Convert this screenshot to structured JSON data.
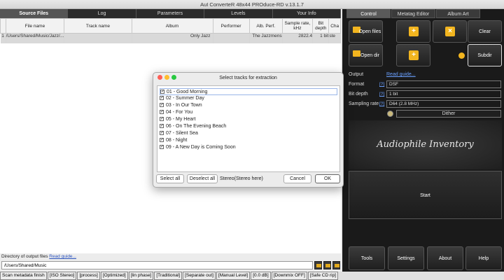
{
  "window": {
    "title": "AuI ConverteR 48x44 PROduce-RD v.13.1.7"
  },
  "left_tabs": [
    "Source Files",
    "Log",
    "Parameters",
    "Levels",
    "Your Info"
  ],
  "table": {
    "columns": [
      "File name",
      "Track name",
      "Album",
      "Performer",
      "Alb. Perf.",
      "Sample rate, kHz",
      "Bit depth",
      "Cha"
    ],
    "row": {
      "index": "1",
      "file": "/Users/Shared/Music/Jazz/...",
      "track": "",
      "album": "Only Jazz",
      "performer": "",
      "alb_perf": "The Jazzmens",
      "rate": "2822.4",
      "bits": "1 bit",
      "cha": "ste"
    }
  },
  "output": {
    "label": "Directory of output files",
    "guide": "Read guide...",
    "path": "/Users/Shared/Music"
  },
  "status": [
    "Scan metadata finish",
    "[ISO Stereo]",
    "[process]",
    "[Optimized]",
    "[lin phase]",
    "[Traditional]",
    "[Separate out]",
    "[Manual Level]",
    "[0.0 dB]",
    "[Downmix OFF]",
    "[Safe CD rip]"
  ],
  "right_tabs": [
    "Control",
    "Metatag Editor",
    "Album Art"
  ],
  "buttons": {
    "open_files": "Open files",
    "clear": "Clear",
    "open_dir": "Open dir",
    "subdir": "Subdir",
    "start": "Start",
    "tools": "Tools",
    "settings": "Settings",
    "about": "About",
    "help": "Help"
  },
  "settings": {
    "output_label": "Output",
    "read_guide": "Read guide...",
    "format_label": "Format",
    "format_value": "DSF",
    "bit_depth_label": "Bit depth",
    "bit_depth_value": "1 bit",
    "rate_label": "Sampling rate",
    "rate_value": "D64 (2.8 MHz)",
    "q": "[?]",
    "dither": "Dither"
  },
  "logo": "Audiophile Inventory",
  "dialog": {
    "title": "Select tracks for extraction",
    "tracks": [
      "01 - Good Morning",
      "02 - Summer Day",
      "03 - In Our Town",
      "04 - For You",
      "05 - My Heart",
      "06 - On The Evening Beach",
      "07 - Silent Sea",
      "08 - Night",
      "09 - A New Day is Coming Soon"
    ],
    "select_all": "Select all",
    "deselect_all": "Deselect all",
    "mode": "Stereo(Stereo here)",
    "cancel": "Cancel",
    "ok": "OK"
  },
  "colors": {
    "accent_folder": "#f2b51f",
    "link": "#2a52be",
    "panel_dark": "#1a1a1a"
  }
}
